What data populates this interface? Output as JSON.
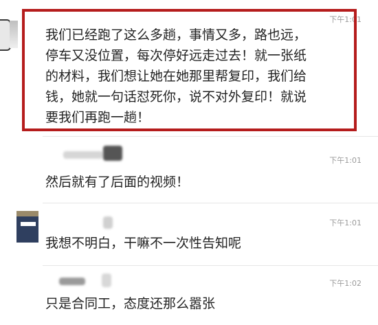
{
  "messages": [
    {
      "time": "下午1:01",
      "lines": [
        "我们已经跑了这么多趟，事情又多，路也远，",
        "停车又没位置，每次停好远走过去！就一张纸",
        "的材料，我们想让她在她那里帮复印，我们给",
        "钱，她就一句话怼死你，说不对外复印！就说",
        "要我们再跑一趟！"
      ]
    },
    {
      "time": "下午1:01",
      "text": "然后就有了后面的视频！"
    },
    {
      "time": "下午1:01",
      "text": "我想不明白，干嘛不一次性告知呢"
    },
    {
      "time": "下午1:02",
      "text": "只是合同工，态度还那么嚣张"
    }
  ],
  "colors": {
    "highlight_border": "#b51c1c",
    "text": "#222222",
    "time": "#9a9a9a"
  }
}
